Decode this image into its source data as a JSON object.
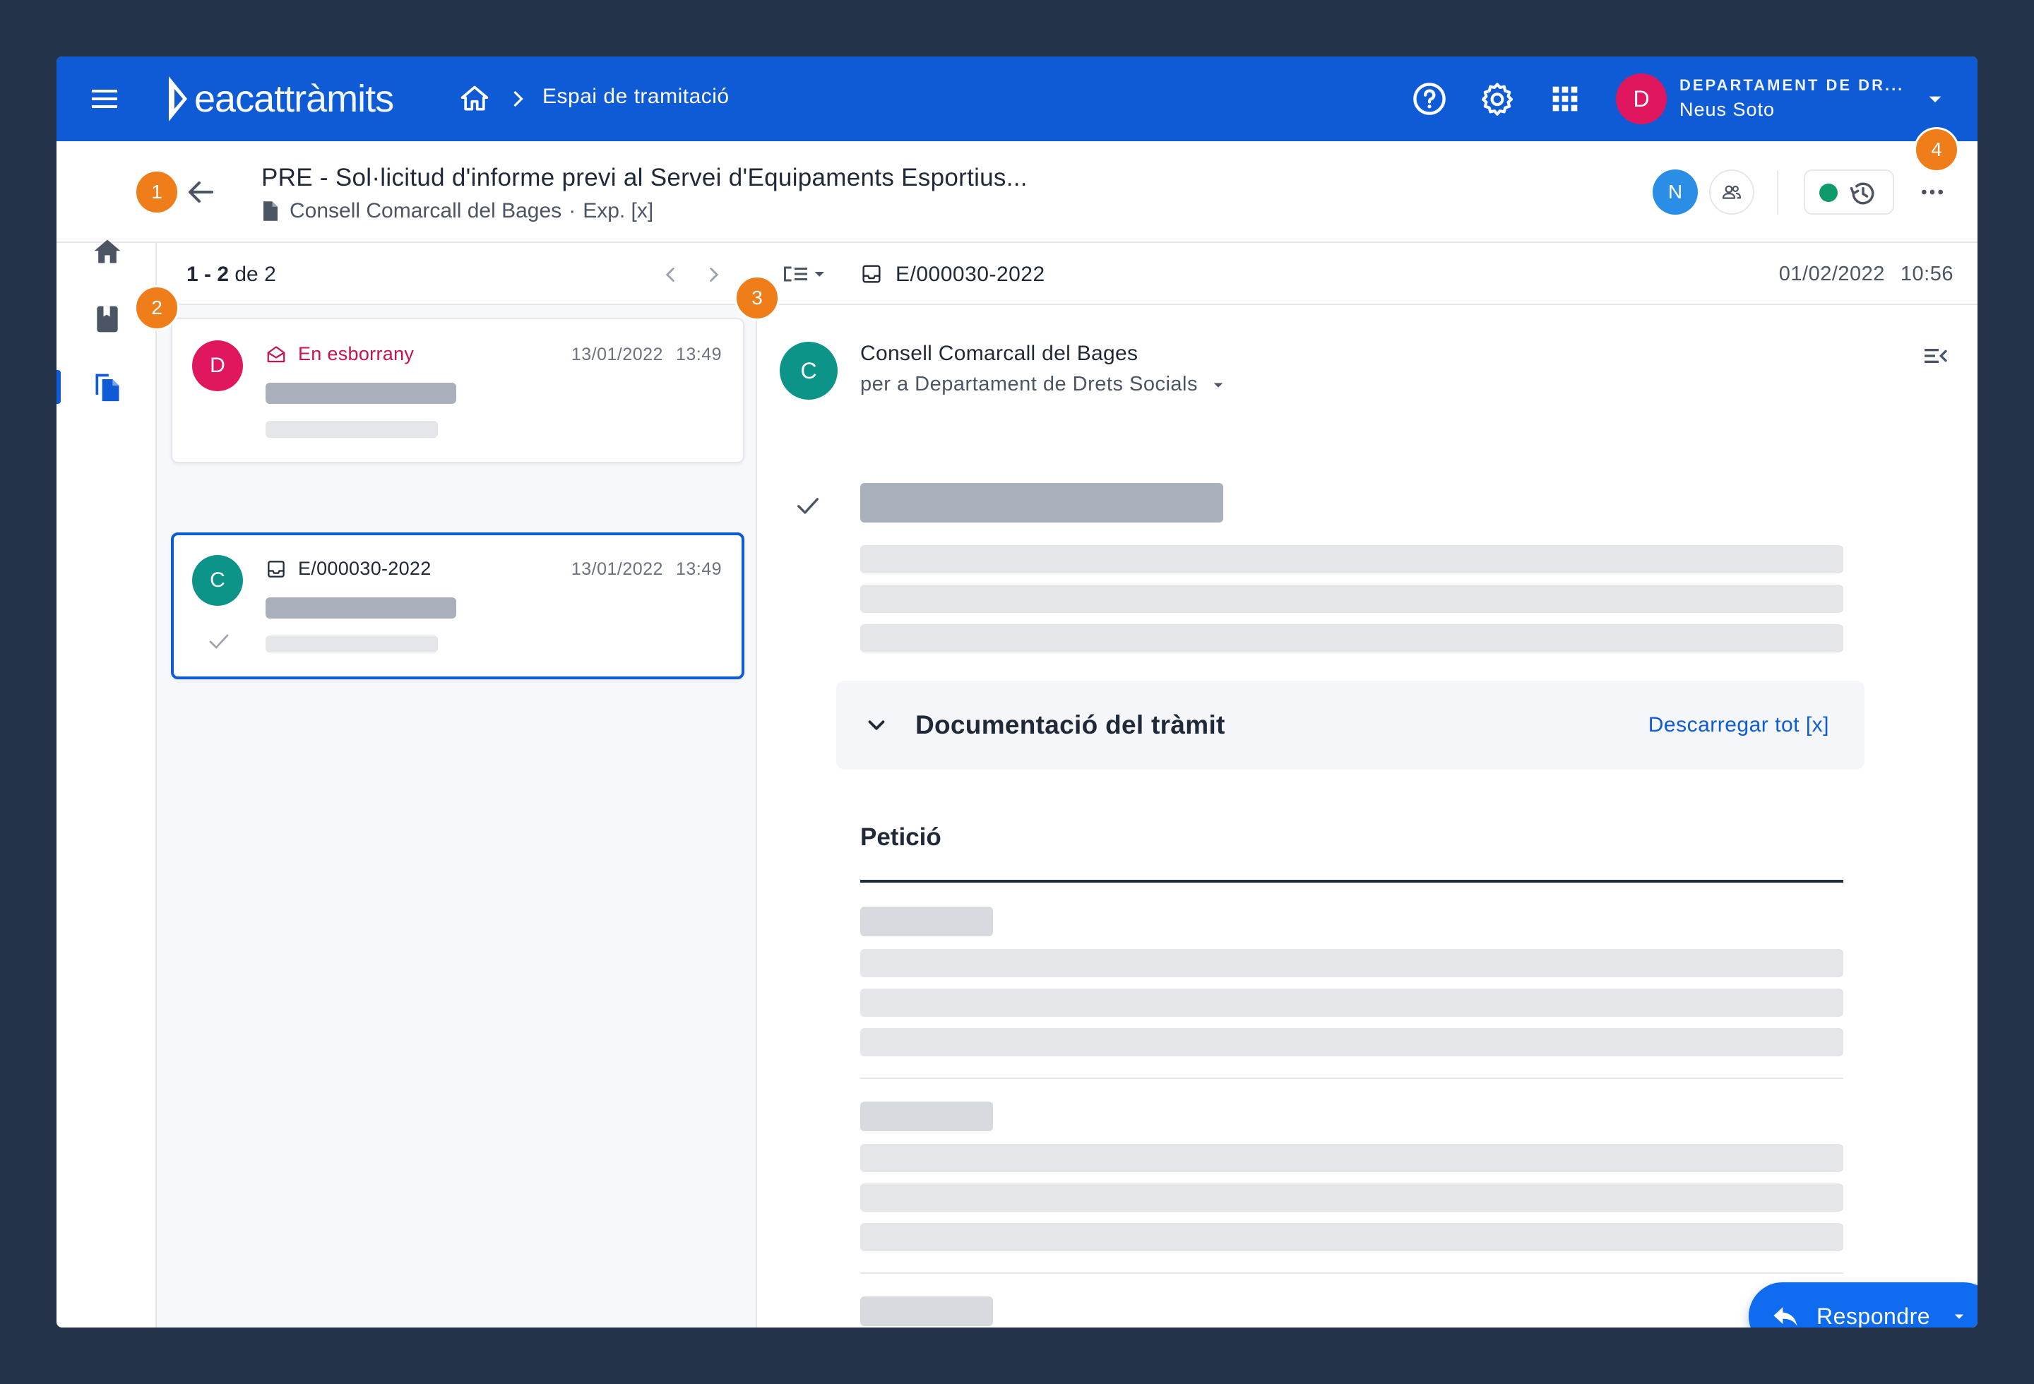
{
  "header": {
    "logo_part1": "eacat",
    "logo_part2": "tràmits",
    "breadcrumb_label": "Espai de tramitació",
    "user_initial": "D",
    "org_name": "DEPARTAMENT DE DR...",
    "user_name": "Neus Soto"
  },
  "procedure": {
    "title": "PRE - Sol·licitud d'informe previ al Servei d'Equipaments Esportius...",
    "organization": "Consell Comarcall del Bages",
    "separator": "·",
    "file_ref": "Exp. [x]",
    "assignee_initial": "N"
  },
  "list": {
    "range": "1 - 2",
    "of_label": "de",
    "total": "2",
    "items": [
      {
        "avatar": "D",
        "avatar_color": "#e0165e",
        "label": "En esborrany",
        "label_color": "#c8134f",
        "date": "13/01/2022",
        "time": "13:49",
        "icon": "envelope-open-icon"
      },
      {
        "avatar": "C",
        "avatar_color": "#0d9488",
        "label": "E/000030-2022",
        "label_color": "#1f2937",
        "date": "13/01/2022",
        "time": "13:49",
        "icon": "inbox-icon"
      }
    ]
  },
  "detail": {
    "registry_number": "E/000030-2022",
    "date": "01/02/2022",
    "time": "10:56",
    "sender_initial": "C",
    "sender_name": "Consell Comarcall del Bages",
    "recipient": "per a Departament de Drets Socials",
    "docs_title": "Documentació del tràmit",
    "docs_link": "Descarregar tot [x]",
    "section_title": "Petició",
    "reply_label": "Respondre"
  },
  "badges": [
    "1",
    "2",
    "3",
    "4"
  ],
  "colors": {
    "brand_blue": "#0f5bd6",
    "badge_orange": "#ef7d1a",
    "status_green": "#0f9a6b"
  }
}
